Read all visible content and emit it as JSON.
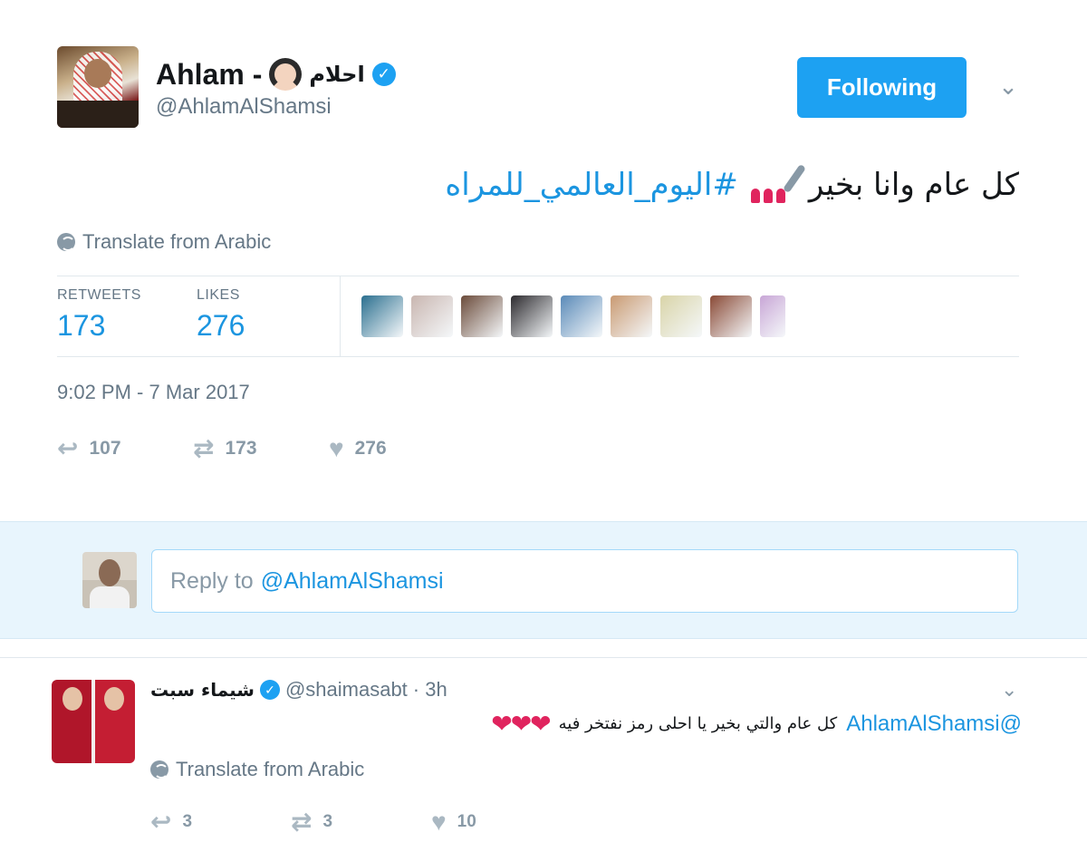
{
  "tweet": {
    "author_name": "Ahlam -",
    "author_name_arabic": "احلام",
    "author_emoji_icon": "woman-face-icon",
    "verified_icon": "verified-badge-icon",
    "handle": "@AhlamAlShamsi",
    "follow_button_label": "Following",
    "caret_icon": "chevron-down-icon",
    "text_arabic": "كل عام وانا بخير",
    "text_emoji_icon": "nail-polish-icon",
    "hashtag": "#اليوم_العالمي_للمراه",
    "translate_label": "Translate from Arabic",
    "retweets_label": "RETWEETS",
    "retweets_count": "173",
    "likes_label": "LIKES",
    "likes_count": "276",
    "likers": [
      {
        "color": "#2a6f8f"
      },
      {
        "color": "#c9b6b0"
      },
      {
        "color": "#6b4b3a"
      },
      {
        "color": "#2c2a2e"
      },
      {
        "color": "#5a8ab8"
      },
      {
        "color": "#c99a72"
      },
      {
        "color": "#d9d4a8"
      },
      {
        "color": "#8a4a36"
      },
      {
        "color": "#c8a6d6"
      }
    ],
    "timestamp": "9:02 PM - 7 Mar 2017",
    "action_reply_count": "107",
    "action_retweet_count": "173",
    "action_like_count": "276"
  },
  "reply_box": {
    "placeholder_prefix": "Reply to",
    "placeholder_mention": "@AhlamAlShamsi"
  },
  "reply": {
    "author_name": "شيماء سبت",
    "handle": "@shaimasabt",
    "time": "· 3h",
    "mention": "@AhlamAlShamsi",
    "text_arabic": "كل عام والتي بخير يا احلى رمز نفتخر فيه",
    "hearts": "❤❤❤",
    "translate_label": "Translate from Arabic",
    "reply_count": "3",
    "retweet_count": "3",
    "like_count": "10"
  },
  "colors": {
    "accent": "#1da1f2",
    "link": "#1b95e0",
    "muted": "#657786",
    "reply_bg": "#e8f5fd"
  }
}
